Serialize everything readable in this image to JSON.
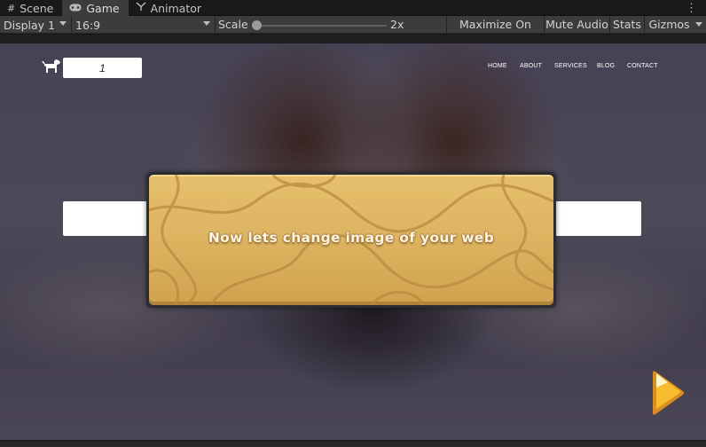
{
  "tabs": [
    {
      "label": "Scene",
      "icon": "grid-icon"
    },
    {
      "label": "Game",
      "icon": "gamepad-icon"
    },
    {
      "label": "Animator",
      "icon": "animator-icon"
    }
  ],
  "toolbar": {
    "display": "Display 1",
    "aspect": "16:9",
    "scale_label": "Scale",
    "scale_value": "2x",
    "maximize": "Maximize On Play",
    "mute": "Mute Audio",
    "stats": "Stats",
    "gizmos": "Gizmos"
  },
  "game": {
    "input_value": "1",
    "nav": [
      "HOME",
      "ABOUT",
      "SERVICES",
      "BLOG",
      "CONTACT"
    ],
    "dialog_text": "Now lets change image of your web",
    "colors": {
      "dialog_fill": "#e0b964",
      "dialog_border": "#2d2c30",
      "next_arrow": "#f5b82e"
    }
  }
}
